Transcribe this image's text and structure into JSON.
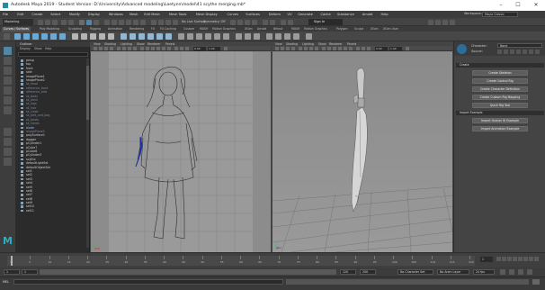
{
  "window": {
    "title": "Autodesk Maya 2019 - Student Version: D:\\University\\Advanced modeling\\Laetynn\\model\\41 scythe merging.mb*",
    "controls": [
      "–",
      "☐",
      "✕"
    ]
  },
  "menubar": {
    "items": [
      "File",
      "Edit",
      "Create",
      "Select",
      "Modify",
      "Display",
      "Windows",
      "Mesh",
      "Edit Mesh",
      "Mesh Tools",
      "Mesh Display",
      "Curves",
      "Surfaces",
      "Deform",
      "UV",
      "Generate",
      "Cache",
      "Substance",
      "Arnold",
      "Help"
    ],
    "workspace_label": "Workspace:",
    "workspace_value": "Maya Classic"
  },
  "statusline": {
    "mode": "Modeling",
    "no_live_surface": "No Live Surface",
    "symmetry": "Symmetry: Off",
    "sign_in": "Sign In"
  },
  "shelf_tabs": [
    "Curves / Surfaces",
    "Poly Modeling",
    "Sculpting",
    "Rigging",
    "Animation",
    "Rendering",
    "FX",
    "FX Caching",
    "Custom",
    "MASH",
    "Motion Graphics",
    "XGen",
    "Arnold",
    "Bifrost",
    "MASH",
    "Motion Graphics",
    "Polygon",
    "Sculpt",
    "XGen",
    "XGen User"
  ],
  "outliner": {
    "title": "Outliner",
    "menus": [
      "Display",
      "Show",
      "Help"
    ],
    "items": [
      {
        "label": "persp",
        "style": "normal"
      },
      {
        "label": "top",
        "style": "normal"
      },
      {
        "label": "front",
        "style": "normal"
      },
      {
        "label": "side",
        "style": "normal"
      },
      {
        "label": "imagePlane1",
        "style": "normal"
      },
      {
        "label": "imagePlane2",
        "style": "normal"
      },
      {
        "label": "sk_head",
        "style": "dim"
      },
      {
        "label": "reference_front",
        "style": "dim"
      },
      {
        "label": "reference_side",
        "style": "dim"
      },
      {
        "label": "sk_body",
        "style": "dim"
      },
      {
        "label": "sk_arms",
        "style": "dim"
      },
      {
        "label": "sk_legs",
        "style": "dim"
      },
      {
        "label": "sk_hair",
        "style": "dim"
      },
      {
        "label": "sk_cloak",
        "style": "dim"
      },
      {
        "label": "sk_belt_and_bag",
        "style": "dim"
      },
      {
        "label": "sk_boots",
        "style": "dim"
      },
      {
        "label": "sk_hands",
        "style": "dim"
      },
      {
        "label": "blade",
        "style": "blue"
      },
      {
        "label": "imagePlane3",
        "style": "dim"
      },
      {
        "label": "polySurface1",
        "style": "normal"
      },
      {
        "label": "dagger",
        "style": "normal"
      },
      {
        "label": "pCylinder1",
        "style": "normal"
      },
      {
        "label": "pCube7",
        "style": "normal"
      },
      {
        "label": "pCube8",
        "style": "normal"
      },
      {
        "label": "pCylinder3",
        "style": "normal"
      },
      {
        "label": "scythe",
        "style": "normal"
      },
      {
        "label": "defaultLightSet",
        "style": "normal"
      },
      {
        "label": "defaultObjectSet",
        "style": "normal"
      },
      {
        "label": "set1",
        "style": "normal"
      },
      {
        "label": "set2",
        "style": "normal"
      },
      {
        "label": "set3",
        "style": "normal"
      },
      {
        "label": "set4",
        "style": "normal"
      },
      {
        "label": "set5",
        "style": "normal"
      },
      {
        "label": "set6",
        "style": "normal"
      },
      {
        "label": "set7",
        "style": "normal"
      },
      {
        "label": "set8",
        "style": "normal"
      },
      {
        "label": "set9",
        "style": "normal"
      },
      {
        "label": "set10",
        "style": "normal"
      },
      {
        "label": "set11",
        "style": "normal"
      }
    ]
  },
  "viewport_left": {
    "menus": [
      "View",
      "Shading",
      "Lighting",
      "Show",
      "Renderer",
      "Panels"
    ],
    "near_clip": "0.00",
    "far_clip": "1.00"
  },
  "viewport_right": {
    "menus": [
      "View",
      "Shading",
      "Lighting",
      "Show",
      "Renderer",
      "Panels"
    ],
    "near_clip": "0.00",
    "far_clip": "1.00"
  },
  "attribute_panel": {
    "character_label": "Character:",
    "character_value": "None",
    "source_label": "Source:",
    "sections": {
      "create": "Create",
      "import_example": "Import Example"
    },
    "buttons": {
      "create_skeleton": "Create Skeleton",
      "create_control_rig": "Create Control Rig",
      "create_character_definition": "Create Character Definition",
      "create_custom_rig_mapping": "Create Custom Rig Mapping",
      "quick_rig_tool": "Quick Rig Tool",
      "import_human_ik_example": "Import Human IK Example",
      "import_animation_example": "Import Animation Example"
    }
  },
  "timeslider": {
    "ticks": [
      "1",
      "5",
      "10",
      "15",
      "20",
      "25",
      "30",
      "35",
      "40",
      "45",
      "50",
      "55",
      "60",
      "65",
      "70",
      "75",
      "80",
      "85",
      "90",
      "95",
      "100",
      "105",
      "110",
      "115",
      "120"
    ],
    "current_frame": "1"
  },
  "rangebar": {
    "start": "1",
    "inner_start": "1",
    "inner_end": "120",
    "end": "120",
    "end2": "200",
    "character_set": "No Character Set",
    "anim_layer": "No Anim Layer",
    "fps": "24 fps"
  },
  "cmdline": {
    "lang": "MEL"
  },
  "colors": {
    "accent": "#5285a6",
    "maya_teal": "#29b0c4",
    "selected_blue": "#1a2fa8"
  }
}
